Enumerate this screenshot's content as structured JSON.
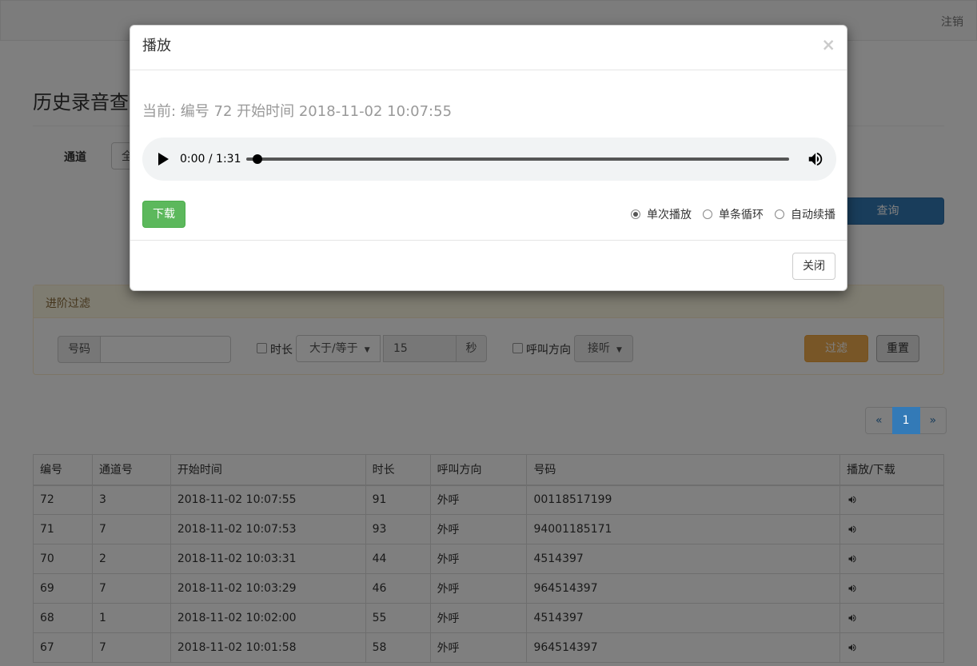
{
  "navbar": {
    "logout": "注销"
  },
  "page": {
    "title": "历史录音查询"
  },
  "search": {
    "channel_label": "通道",
    "channel_value": "全",
    "query_button": "查询"
  },
  "filter": {
    "heading": "进阶过滤",
    "number_label": "号码",
    "number_value": "",
    "duration_label": "时长",
    "duration_op": "大于/等于",
    "duration_value": "15",
    "duration_unit": "秒",
    "direction_label": "呼叫方向",
    "direction_value": "接听",
    "filter_button": "过滤",
    "reset_button": "重置"
  },
  "pagination": {
    "prev": "«",
    "current": "1",
    "next": "»"
  },
  "table": {
    "headers": [
      "编号",
      "通道号",
      "开始时间",
      "时长",
      "呼叫方向",
      "号码",
      "播放/下载"
    ],
    "rows": [
      [
        "72",
        "3",
        "2018-11-02 10:07:55",
        "91",
        "外呼",
        "00118517199"
      ],
      [
        "71",
        "7",
        "2018-11-02 10:07:53",
        "93",
        "外呼",
        "94001185171"
      ],
      [
        "70",
        "2",
        "2018-11-02 10:03:31",
        "44",
        "外呼",
        "4514397"
      ],
      [
        "69",
        "7",
        "2018-11-02 10:03:29",
        "46",
        "外呼",
        "964514397"
      ],
      [
        "68",
        "1",
        "2018-11-02 10:02:00",
        "55",
        "外呼",
        "4514397"
      ],
      [
        "67",
        "7",
        "2018-11-02 10:01:58",
        "58",
        "外呼",
        "964514397"
      ]
    ]
  },
  "modal": {
    "title": "播放",
    "close_symbol": "×",
    "now_playing": "当前: 编号 72 开始时间 2018-11-02 10:07:55",
    "player": {
      "time": "0:00 / 1:31",
      "progress": 0.02
    },
    "download_button": "下载",
    "play_modes": [
      {
        "label": "单次播放",
        "selected": true
      },
      {
        "label": "单条循环",
        "selected": false
      },
      {
        "label": "自动续播",
        "selected": false
      }
    ],
    "close_button": "关闭"
  },
  "colors": {
    "primary": "#337ab7",
    "success": "#5cb85c",
    "warning": "#f0ad4e"
  }
}
